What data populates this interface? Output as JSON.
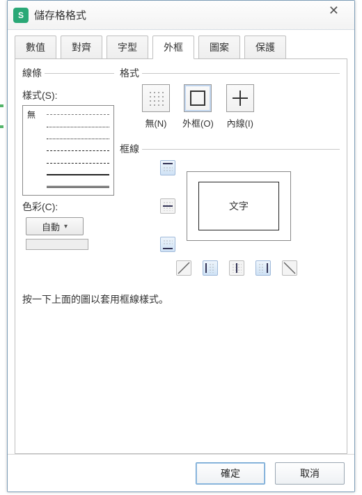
{
  "window": {
    "title": "儲存格格式"
  },
  "tabs": {
    "items": [
      {
        "label": "數值",
        "active": false
      },
      {
        "label": "對齊",
        "active": false
      },
      {
        "label": "字型",
        "active": false
      },
      {
        "label": "外框",
        "active": true
      },
      {
        "label": "圖案",
        "active": false
      },
      {
        "label": "保護",
        "active": false
      }
    ]
  },
  "line_section": {
    "legend": "線條",
    "style_label": "樣式(S):",
    "none_label": "無",
    "color_label": "色彩(C):",
    "color_value": "自動"
  },
  "presets_section": {
    "legend": "格式",
    "items": [
      {
        "label": "無(N)"
      },
      {
        "label": "外框(O)"
      },
      {
        "label": "內線(I)"
      }
    ]
  },
  "border_section": {
    "legend": "框線",
    "preview_text": "文字"
  },
  "hint": "按一下上面的圖以套用框線樣式。",
  "footer": {
    "ok": "確定",
    "cancel": "取消"
  }
}
